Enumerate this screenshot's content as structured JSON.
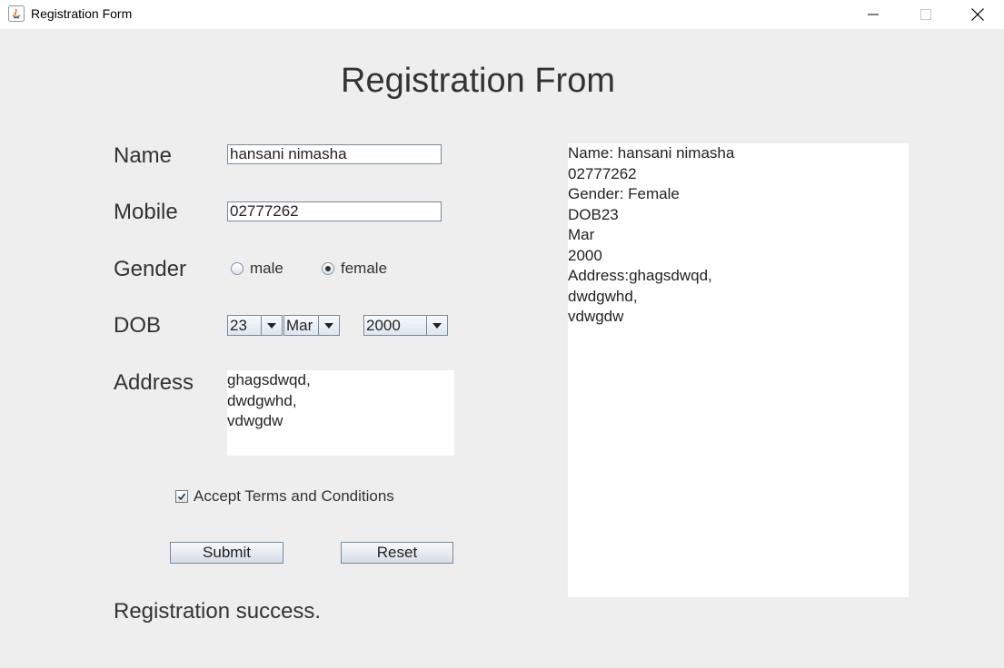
{
  "window": {
    "title": "Registration Form",
    "controls": [
      "minimize-icon",
      "maximize-icon",
      "close-icon"
    ]
  },
  "form": {
    "heading": "Registration From",
    "name": {
      "label": "Name",
      "value": "hansani nimasha"
    },
    "mobile": {
      "label": "Mobile",
      "value": "02777262"
    },
    "gender": {
      "label": "Gender",
      "options": [
        {
          "label": "male",
          "selected": false
        },
        {
          "label": "female",
          "selected": true
        }
      ]
    },
    "dob": {
      "label": "DOB",
      "day": "23",
      "month": "Mar",
      "year": "2000"
    },
    "address": {
      "label": "Address",
      "value": "ghagsdwqd,\ndwdgwhd,\nvdwgdw"
    },
    "terms": {
      "label": "Accept Terms and Conditions",
      "checked": true
    },
    "buttons": {
      "submit": "Submit",
      "reset": "Reset"
    },
    "status": "Registration success."
  },
  "output": {
    "text": "Name: hansani nimasha\n02777262\nGender: Female\nDOB23\nMar\n2000\nAddress:ghagsdwqd,\ndwdgwhd,\nvdwgdw"
  },
  "colors": {
    "background": "#eeeeee",
    "titlebar": "#ffffff",
    "field_border": "#7a8a99",
    "text": "#333333"
  }
}
